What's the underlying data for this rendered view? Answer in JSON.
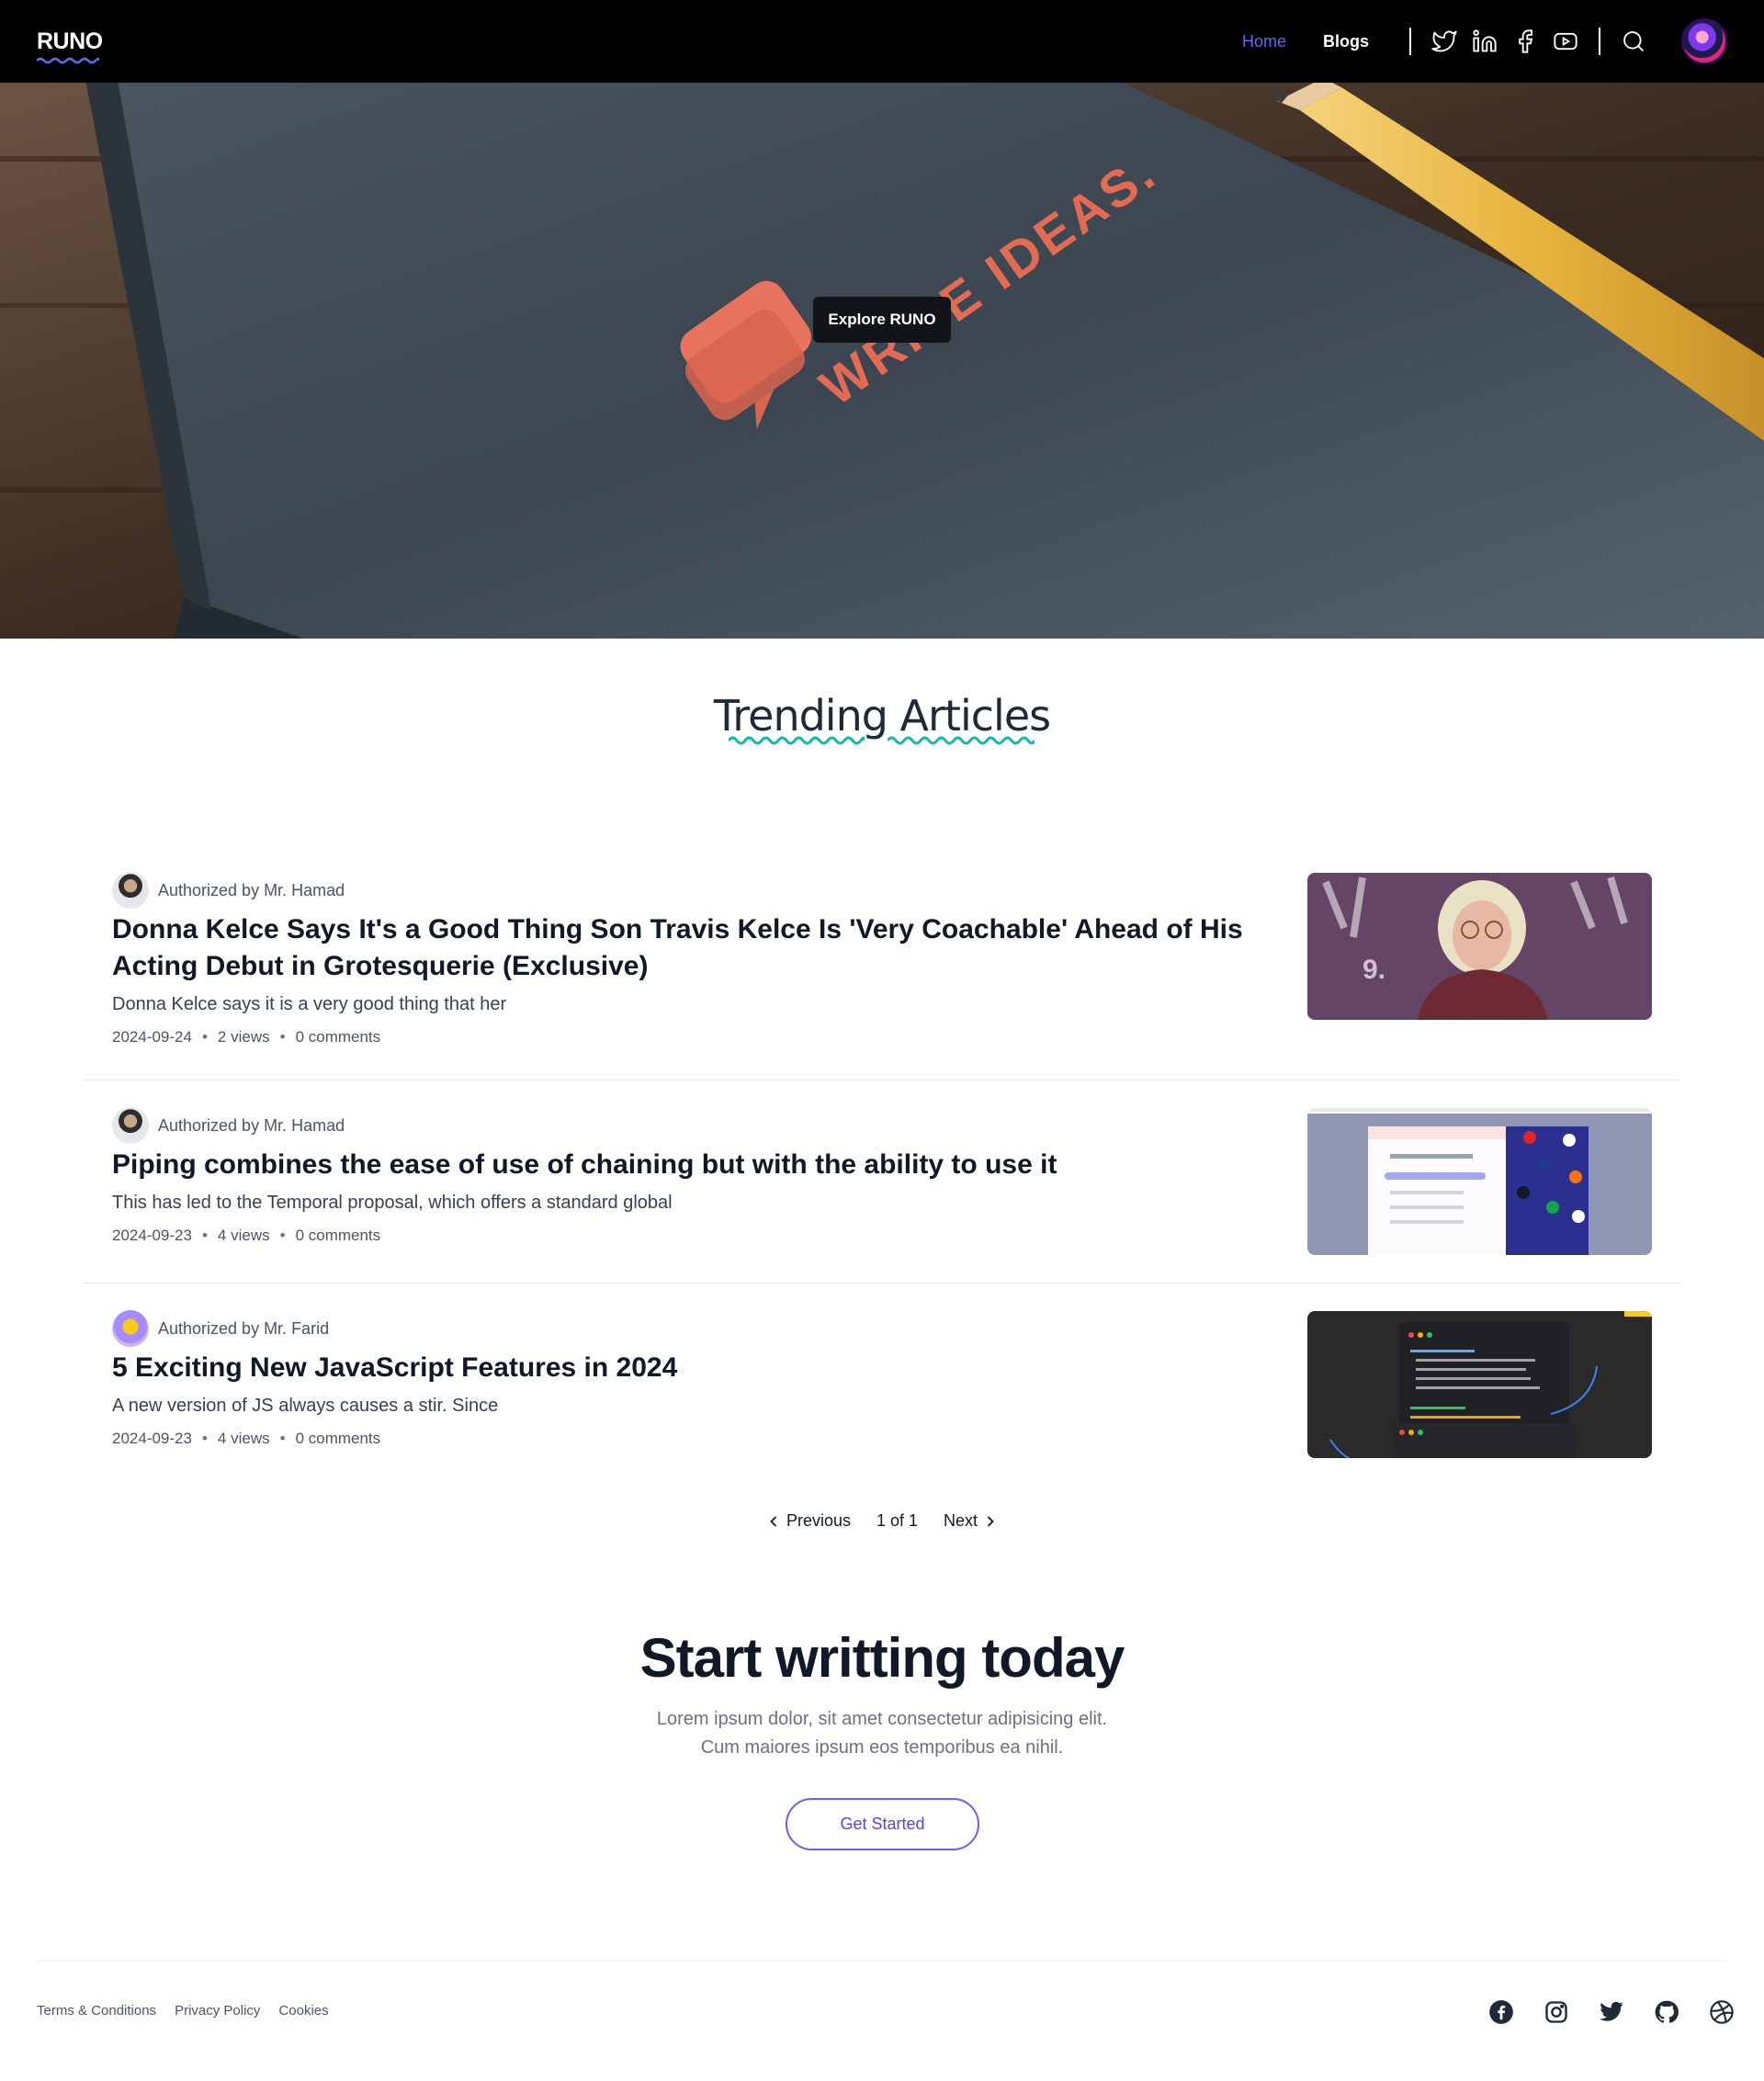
{
  "header": {
    "logo": "RUNO",
    "nav": [
      {
        "label": "Home"
      },
      {
        "label": "Blogs"
      }
    ],
    "social_icons": [
      "twitter-icon",
      "linkedin-icon",
      "facebook-icon",
      "youtube-icon"
    ],
    "accent_color": "#6366f1"
  },
  "hero": {
    "button_label": "Explore RUNO"
  },
  "trending": {
    "title": "Trending Articles",
    "articles": [
      {
        "author": "Authorized by Mr. Hamad",
        "title": "Donna Kelce Says It's a Good Thing Son Travis Kelce Is 'Very Coachable' Ahead of His Acting Debut in Grotesquerie (Exclusive)",
        "excerpt": "Donna Kelce says it is a very good thing that her",
        "date": "2024-09-24",
        "views": "2 views",
        "comments": "0 comments"
      },
      {
        "author": "Authorized by Mr. Hamad",
        "title": "Piping combines the ease of use of chaining but with the ability to use it",
        "excerpt": "This has led to the Temporal proposal, which offers a standard global",
        "date": "2024-09-23",
        "views": "4 views",
        "comments": "0 comments"
      },
      {
        "author": "Authorized by Mr. Farid",
        "title": "5 Exciting New JavaScript Features in 2024",
        "excerpt": "A new version of JS always causes a stir. Since",
        "date": "2024-09-23",
        "views": "4 views",
        "comments": "0 comments"
      }
    ]
  },
  "pagination": {
    "previous": "Previous",
    "info": "1 of 1",
    "next": "Next"
  },
  "cta": {
    "title": "Start writting today",
    "text": "Lorem ipsum dolor, sit amet consectetur adipisicing elit. Cum maiores ipsum eos temporibus ea nihil.",
    "button": "Get Started"
  },
  "footer": {
    "links": [
      "Terms & Conditions",
      "Privacy Policy",
      "Cookies"
    ],
    "social_icons": [
      "facebook-icon",
      "instagram-icon",
      "twitter-icon",
      "github-icon",
      "dribbble-icon"
    ]
  }
}
